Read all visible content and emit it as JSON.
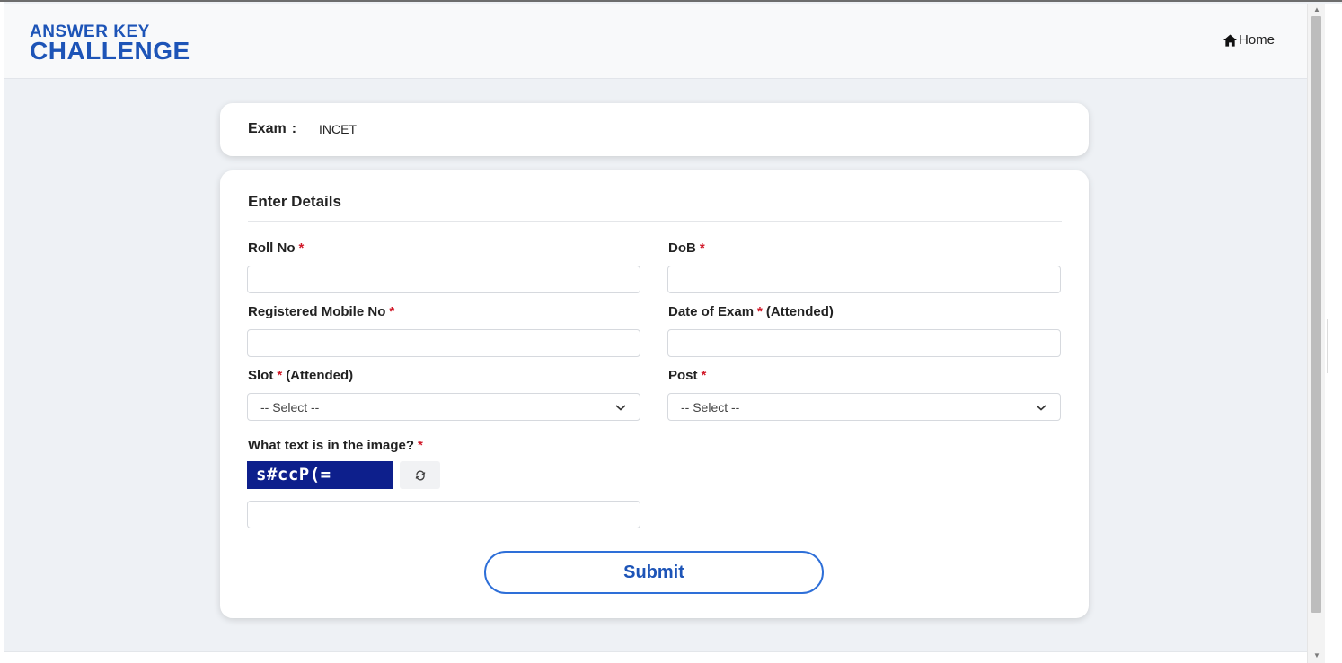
{
  "header": {
    "logo_line1": "ANSWER KEY",
    "logo_line2": "CHALLENGE",
    "home_label": "Home"
  },
  "exam": {
    "label": "Exam",
    "colon": ":",
    "value": "INCET"
  },
  "form": {
    "title": "Enter Details",
    "required_mark": "*",
    "roll_no": {
      "label": "Roll No",
      "value": ""
    },
    "dob": {
      "label": "DoB",
      "value": ""
    },
    "mobile": {
      "label": "Registered Mobile No",
      "value": ""
    },
    "exam_date": {
      "label": "Date of Exam",
      "suffix": "(Attended)",
      "value": ""
    },
    "slot": {
      "label": "Slot",
      "suffix": "(Attended)",
      "selected": "-- Select --"
    },
    "post": {
      "label": "Post",
      "selected": "-- Select --"
    },
    "captcha": {
      "label": "What text is in the image?",
      "image_text": "s#ccP(=",
      "value": ""
    },
    "submit_label": "Submit"
  },
  "colors": {
    "brand": "#1d54b7",
    "required": "#d11a2a",
    "captcha_bg": "#0d1f8c",
    "page_bg": "#eef1f5"
  },
  "icons": {
    "home": "home-icon",
    "select_arrow": "chevron-down-icon",
    "refresh": "refresh-icon"
  }
}
